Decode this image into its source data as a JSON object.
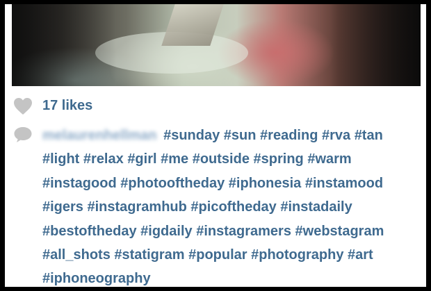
{
  "post": {
    "likes_text": "17 likes",
    "username": "melaurenhellman",
    "hashtags": [
      "#sunday",
      "#sun",
      "#reading",
      "#rva",
      "#tan",
      "#light",
      "#relax",
      "#girl",
      "#me",
      "#outside",
      "#spring",
      "#warm",
      "#instagood",
      "#photooftheday",
      "#iphonesia",
      "#instamood",
      "#igers",
      "#instagramhub",
      "#picoftheday",
      "#instadaily",
      "#bestoftheday",
      "#igdaily",
      "#instagramers",
      "#webstagram",
      "#all_shots",
      "#statigram",
      "#popular",
      "#photography",
      "#art",
      "#iphoneography"
    ]
  },
  "icons": {
    "like": "heart-icon",
    "comment": "comment-bubble-icon"
  },
  "colors": {
    "link_blue": "#3f6a8f",
    "icon_gray": "#c4c4c4",
    "background": "#ffffff",
    "outer_border": "#000000"
  }
}
